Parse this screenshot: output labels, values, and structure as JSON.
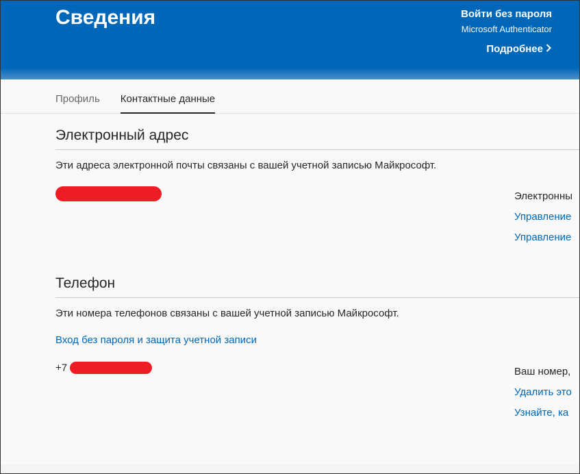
{
  "header": {
    "title": "Сведения",
    "signin_label": "Войти без пароля",
    "authenticator_label": "Microsoft Authenticator",
    "more_label": "Подробнее"
  },
  "tabs": {
    "profile": "Профиль",
    "contact": "Контактные данные"
  },
  "email_section": {
    "title": "Электронный адрес",
    "description": "Эти адреса электронной почты связаны с вашей учетной записью Майкрософт.",
    "redacted_value": "",
    "right": {
      "label": "Электронны",
      "manage1": "Управление",
      "manage2": "Управление"
    }
  },
  "phone_section": {
    "title": "Телефон",
    "description": "Эти номера телефонов связаны с вашей учетной записью Майкрософт.",
    "passwordless_link": "Вход без пароля и защита учетной записи",
    "prefix": "+7",
    "redacted_value": "",
    "right": {
      "label": "Ваш номер,",
      "delete": "Удалить это",
      "learn": "Узнайте, ка"
    }
  }
}
